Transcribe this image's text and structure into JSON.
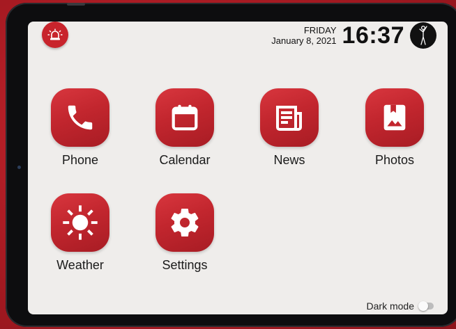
{
  "header": {
    "alarm_icon": "siren-icon",
    "day": "FRIDAY",
    "date": "January 8, 2021",
    "time": "16:37",
    "avatar_icon": "stick-figure-icon"
  },
  "apps": [
    {
      "label": "Phone",
      "icon": "phone-icon"
    },
    {
      "label": "Calendar",
      "icon": "calendar-icon"
    },
    {
      "label": "News",
      "icon": "newspaper-icon"
    },
    {
      "label": "Photos",
      "icon": "photo-album-icon"
    },
    {
      "label": "Weather",
      "icon": "sun-icon"
    },
    {
      "label": "Settings",
      "icon": "gear-icon"
    }
  ],
  "footer": {
    "dark_mode_label": "Dark mode",
    "dark_mode_on": false
  },
  "colors": {
    "accent": "#c8242c",
    "screen_bg": "#efedeb",
    "bezel": "#0d0d0f",
    "wallpaper": "#a61a22"
  }
}
